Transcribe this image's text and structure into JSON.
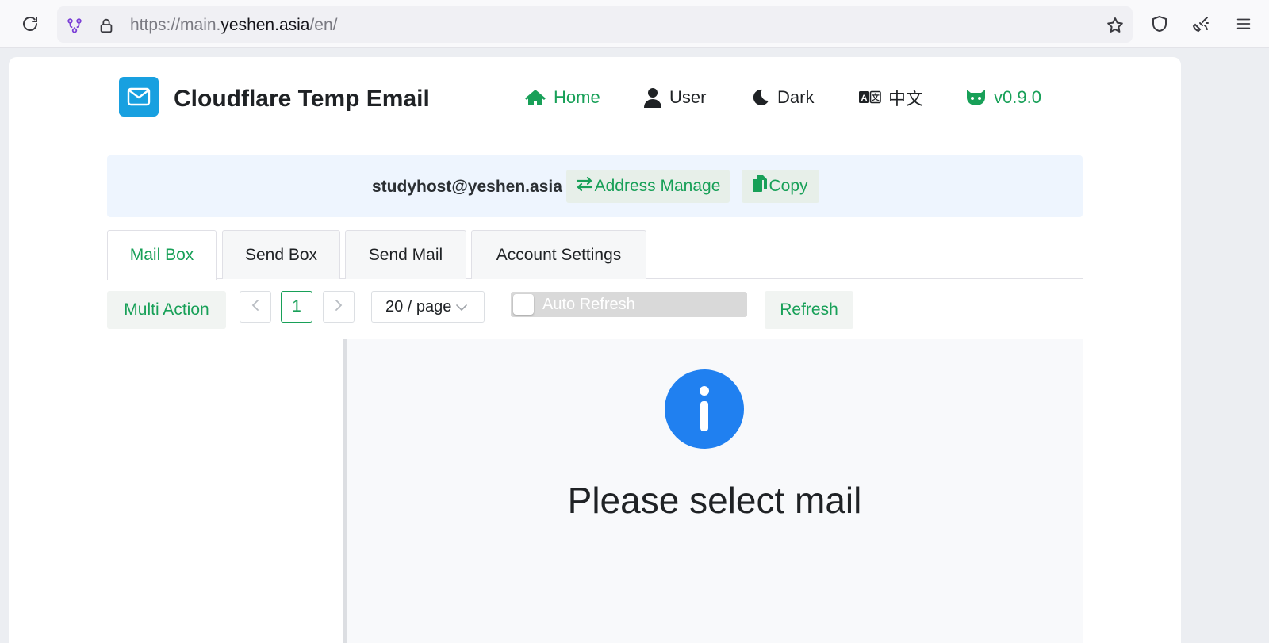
{
  "browser": {
    "url_scheme": "https://main.",
    "url_host": "yeshen.asia",
    "url_path": "/en/"
  },
  "header": {
    "site_title": "Cloudflare Temp Email",
    "nav": {
      "home": "Home",
      "user": "User",
      "dark": "Dark",
      "language": "中文",
      "version": "v0.9.0"
    }
  },
  "address": {
    "email": "studyhost@yeshen.asia",
    "manage_label": "Address Manage",
    "copy_label": "Copy"
  },
  "tabs": [
    {
      "label": "Mail Box",
      "active": true
    },
    {
      "label": "Send Box",
      "active": false
    },
    {
      "label": "Send Mail",
      "active": false
    },
    {
      "label": "Account Settings",
      "active": false
    }
  ],
  "toolbar": {
    "multi_action": "Multi Action",
    "current_page": "1",
    "page_size": "20 / page",
    "auto_refresh_label": "Auto Refresh",
    "auto_refresh_on": false,
    "refresh": "Refresh"
  },
  "detail": {
    "empty_message": "Please select mail"
  },
  "colors": {
    "accent": "#18a058",
    "info_blue": "#2080f0",
    "logo_blue": "#18a0e0",
    "address_bar_bg": "#eef5fe"
  }
}
